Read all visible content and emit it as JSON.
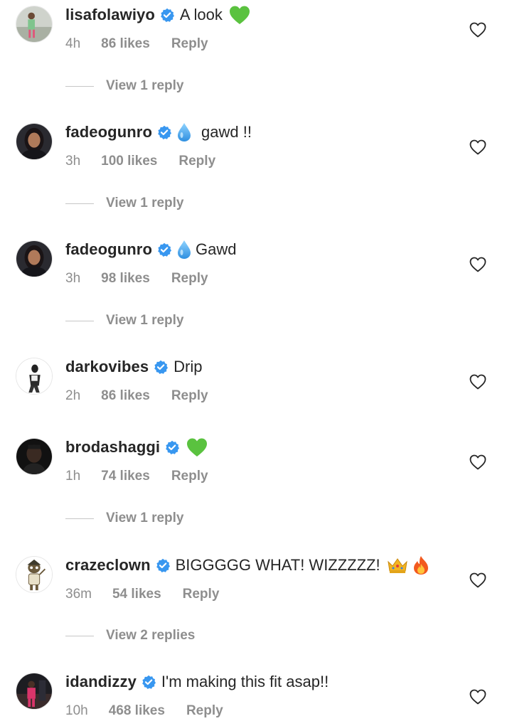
{
  "comments": [
    {
      "username": "lisafolawiyo",
      "text": "A look",
      "emojis": [
        "green-heart"
      ],
      "time": "4h",
      "likes": "86 likes",
      "reply_label": "Reply",
      "view_replies": "View 1 reply"
    },
    {
      "username": "fadeogunro",
      "prefix_emoji": "droplet",
      "text": "gawd !!",
      "time": "3h",
      "likes": "100 likes",
      "reply_label": "Reply",
      "view_replies": "View 1 reply"
    },
    {
      "username": "fadeogunro",
      "prefix_emoji": "droplet",
      "text": "Gawd",
      "time": "3h",
      "likes": "98 likes",
      "reply_label": "Reply",
      "view_replies": "View 1 reply"
    },
    {
      "username": "darkovibes",
      "text": "Drip",
      "time": "2h",
      "likes": "86 likes",
      "reply_label": "Reply"
    },
    {
      "username": "brodashaggi",
      "text": "",
      "emojis": [
        "green-heart"
      ],
      "time": "1h",
      "likes": "74 likes",
      "reply_label": "Reply",
      "view_replies": "View 1 reply"
    },
    {
      "username": "crazeclown",
      "text": "BIGGGGG WHAT! WIZZZZZ!",
      "emojis": [
        "crown",
        "fire"
      ],
      "time": "36m",
      "likes": "54 likes",
      "reply_label": "Reply",
      "view_replies": "View 2 replies"
    },
    {
      "username": "idandizzy",
      "text": "I'm making this fit asap!!",
      "time": "10h",
      "likes": "468 likes",
      "reply_label": "Reply"
    }
  ],
  "icons": {
    "verified_badge": "verified-badge-icon",
    "like": "heart-outline-icon"
  },
  "colors": {
    "verified": "#3897f0",
    "secondary_text": "#8e8e8e",
    "primary_text": "#262626"
  }
}
